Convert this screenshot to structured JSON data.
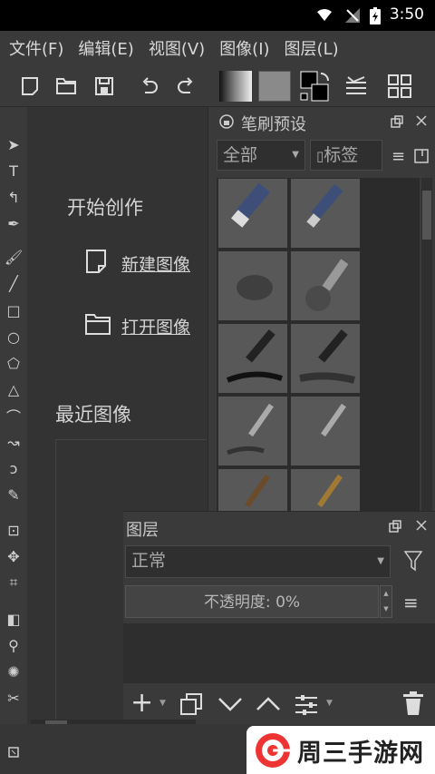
{
  "status": {
    "time": "3:50"
  },
  "menu": [
    "文件(F)",
    "编辑(E)",
    "视图(V)",
    "图像(I)",
    "图层(L)"
  ],
  "welcome": {
    "start_title": "开始创作",
    "new_image": "新建图像",
    "open_image": "打开图像",
    "recent_title": "最近图像"
  },
  "brush_docker": {
    "title": "笔刷预设",
    "filter_value": "全部",
    "tag_label": "标签"
  },
  "layers_docker": {
    "title": "图层",
    "blend_mode": "正常",
    "opacity_label": "不透明度:  0%"
  },
  "watermark": {
    "text": "周三手游网"
  },
  "colors": {
    "bg": "#323232",
    "panel": "#3a3a3a",
    "text": "#cfcfcf"
  }
}
